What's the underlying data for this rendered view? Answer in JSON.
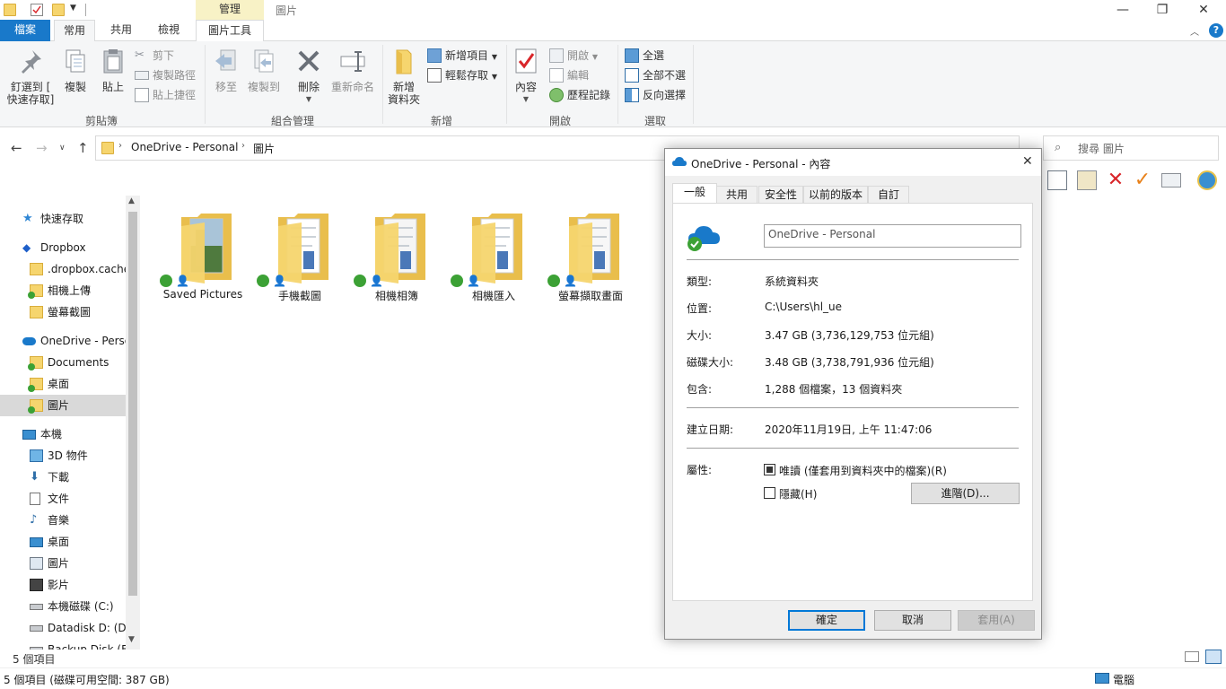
{
  "window": {
    "context_tab_group": "管理",
    "title": "圖片",
    "controls": {
      "minimize": "—",
      "maximize": "❐",
      "close": "✕"
    }
  },
  "ribbon_tabs": {
    "file": "檔案",
    "home": "常用",
    "share": "共用",
    "view": "檢視",
    "picture_tools": "圖片工具",
    "help": "?"
  },
  "ribbon": {
    "clipboard": {
      "label": "剪貼簿",
      "pin": [
        "釘選到 [",
        "快速存取]"
      ],
      "copy": "複製",
      "paste": "貼上",
      "cut": "剪下",
      "copy_path": "複製路徑",
      "paste_shortcut": "貼上捷徑"
    },
    "organize": {
      "label": "組合管理",
      "move_to": "移至",
      "copy_to": "複製到",
      "delete": "刪除",
      "rename": "重新命名"
    },
    "new": {
      "label": "新增",
      "new_folder": [
        "新增",
        "資料夾"
      ],
      "new_item": "新增項目",
      "easy_access": "輕鬆存取"
    },
    "open": {
      "label": "開啟",
      "properties": "內容",
      "open": "開啟",
      "edit": "編輯",
      "history": "歷程記錄"
    },
    "select": {
      "label": "選取",
      "select_all": "全選",
      "select_none": "全部不選",
      "invert": "反向選擇"
    }
  },
  "address": {
    "path": [
      "OneDrive - Personal",
      "圖片"
    ],
    "search_placeholder": "搜尋 圖片"
  },
  "nav_pane": [
    {
      "label": "快速存取",
      "icon": "star-icon",
      "indent": 0
    },
    {
      "label": "Dropbox",
      "icon": "dropbox-icon",
      "indent": 0
    },
    {
      "label": ".dropbox.cache",
      "icon": "folder-icon",
      "indent": 1
    },
    {
      "label": "相機上傳",
      "icon": "folder-sync-icon",
      "indent": 1
    },
    {
      "label": "螢幕截圖",
      "icon": "folder-icon",
      "indent": 1
    },
    {
      "label": "OneDrive - Personal",
      "icon": "onedrive-icon",
      "indent": 0
    },
    {
      "label": "Documents",
      "icon": "folder-sync-icon",
      "indent": 1
    },
    {
      "label": "桌面",
      "icon": "folder-sync-icon",
      "indent": 1
    },
    {
      "label": "圖片",
      "icon": "folder-sync-icon",
      "indent": 1
    },
    {
      "label": "本機",
      "icon": "computer-icon",
      "indent": 0
    },
    {
      "label": "3D 物件",
      "icon": "cube-icon",
      "indent": 1
    },
    {
      "label": "下載",
      "icon": "download-icon",
      "indent": 1
    },
    {
      "label": "文件",
      "icon": "document-icon",
      "indent": 1
    },
    {
      "label": "音樂",
      "icon": "music-icon",
      "indent": 1
    },
    {
      "label": "桌面",
      "icon": "desktop-icon",
      "indent": 1
    },
    {
      "label": "圖片",
      "icon": "pictures-icon",
      "indent": 1
    },
    {
      "label": "影片",
      "icon": "video-icon",
      "indent": 1
    },
    {
      "label": "本機磁碟 (C:)",
      "icon": "drive-icon",
      "indent": 1
    },
    {
      "label": "Datadisk D:  (D:",
      "icon": "drive-icon",
      "indent": 1
    },
    {
      "label": "Backup Disk (F",
      "icon": "drive-icon",
      "indent": 1
    }
  ],
  "files": [
    {
      "name": "Saved Pictures"
    },
    {
      "name": "手機截圖"
    },
    {
      "name": "相機相簿"
    },
    {
      "name": "相機匯入"
    },
    {
      "name": "螢幕擷取畫面"
    }
  ],
  "status": {
    "item_count": "5 個項目",
    "free_space": "5 個項目 (磁碟可用空間: 387 GB)",
    "computer": "電腦"
  },
  "dialog": {
    "title": "OneDrive - Personal - 內容",
    "tabs": [
      "一般",
      "共用",
      "安全性",
      "以前的版本",
      "自訂"
    ],
    "name_value": "OneDrive - Personal",
    "type_label": "類型:",
    "type_value": "系統資料夾",
    "location_label": "位置:",
    "location_value": "C:\\Users\\hl_ue",
    "size_label": "大小:",
    "size_value": "3.47 GB (3,736,129,753 位元組)",
    "disk_size_label": "磁碟大小:",
    "disk_size_value": "3.48 GB (3,738,791,936 位元組)",
    "contains_label": "包含:",
    "contains_value": "1,288 個檔案，13 個資料夾",
    "created_label": "建立日期:",
    "created_value": "2020年11月19日, 上午 11:47:06",
    "attr_label": "屬性:",
    "readonly_label": "唯讀 (僅套用到資料夾中的檔案)(R)",
    "hidden_label": "隱藏(H)",
    "advanced_button": "進階(D)...",
    "ok": "確定",
    "cancel": "取消",
    "apply": "套用(A)"
  },
  "colors": {
    "accent": "#1979ca",
    "folder": "#f6d56e",
    "sync_green": "#3ca135",
    "delete_red": "#d9262a"
  }
}
